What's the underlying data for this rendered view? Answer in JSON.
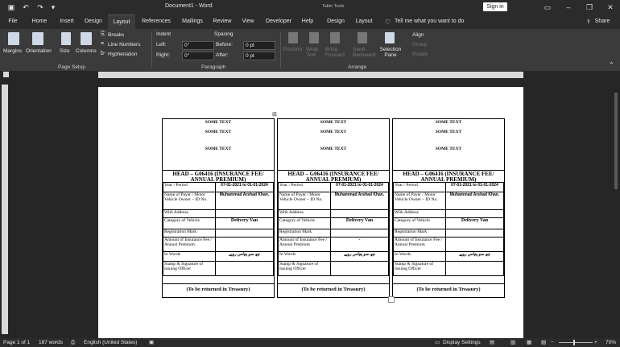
{
  "window": {
    "title": "Document1 - Word",
    "context_label": "Table Tools",
    "signin": "Sign in"
  },
  "quick_access": {
    "undo": "↶",
    "redo": "↷"
  },
  "tabs": [
    {
      "label": "File"
    },
    {
      "label": "Home"
    },
    {
      "label": "Insert"
    },
    {
      "label": "Design"
    },
    {
      "label": "Layout"
    },
    {
      "label": "References"
    },
    {
      "label": "Mailings"
    },
    {
      "label": "Review"
    },
    {
      "label": "View"
    },
    {
      "label": "Developer"
    },
    {
      "label": "Help"
    },
    {
      "label": "Design"
    },
    {
      "label": "Layout"
    }
  ],
  "tell_me": "Tell me what you want to do",
  "share": "Share",
  "ribbon": {
    "margins": "Margins",
    "orientation": "Orientation",
    "size": "Size",
    "columns": "Columns",
    "breaks": "Breaks",
    "line_numbers": "Line Numbers",
    "hyphenation": "Hyphenation",
    "page_setup_label": "Page Setup",
    "indent_label": "Indent",
    "spacing_label": "Spacing",
    "left_label": "Left:",
    "right_label": "Right:",
    "before_label": "Before:",
    "after_label": "After:",
    "left_value": "0\"",
    "right_value": "0\"",
    "before_value": "0 pt",
    "after_value": "0 pt",
    "paragraph_label": "Paragraph",
    "position": "Position",
    "wrap_text": "Wrap Text",
    "bring_forward": "Bring Forward",
    "send_backward": "Send Backward",
    "selection_pane": "Selection Pane",
    "align": "Align",
    "group": "Group",
    "rotate": "Rotate",
    "arrange_label": "Arrange"
  },
  "cards": [
    {
      "some_text": [
        "SOME TEXT",
        "SOME TEXT",
        "SOME TEXT"
      ],
      "head": "HEAD – G06416 (INSURANCE FEE/ ANNUAL PREMIUM)",
      "rows": [
        {
          "label": "Year / Period",
          "value": "07-01-2021 to 01-01-2024"
        },
        {
          "label": "Name of Payer / Motor Vehicle Owner – ID No.",
          "value": "Muhammad Arshad Khan."
        },
        {
          "label": "With Address",
          "value": ""
        },
        {
          "label": "Category of Vehicle",
          "value": "Delivery Van"
        },
        {
          "label": "Registration Mark",
          "value": ""
        },
        {
          "label": "Amount of Insurance Fee / Annual Premium",
          "value": ""
        },
        {
          "label": "In Words",
          "value": "چھ سو پچاس روپے"
        },
        {
          "label": "Stamp & Signature of Issuing Officer",
          "value": ""
        }
      ],
      "footer": "(To be returned in Treasury)"
    },
    {
      "some_text": [
        "SOME TEXT",
        "SOME TEXT",
        "SOME TEXT"
      ],
      "head": "HEAD – G06416 (INSURANCE FEE/ ANNUAL PREMIUM)",
      "rows": [
        {
          "label": "Year / Period",
          "value": "07-01-2021 to 01-01-2024"
        },
        {
          "label": "Name of Payer / Motor Vehicle Owner – ID No.",
          "value": "Muhammad Arshad Khan."
        },
        {
          "label": "With Address",
          "value": ""
        },
        {
          "label": "Category of Vehicle",
          "value": "Delivery Van"
        },
        {
          "label": "Registration Mark",
          "value": ""
        },
        {
          "label": "Amount of Insurance Fee / Annual Premium",
          "value": "-"
        },
        {
          "label": "In Words",
          "value": "چھ سو پچاس روپے"
        },
        {
          "label": "Stamp & Signature of Issuing Officer",
          "value": ""
        }
      ],
      "footer": "(To be returned in Treasury)"
    },
    {
      "some_text": [
        "SOME TEXT",
        "SOME TEXT",
        "SOME TEXT"
      ],
      "head": "HEAD – G06416 (INSURANCE FEE/ ANNUAL PREMIUM)",
      "rows": [
        {
          "label": "Year / Period",
          "value": "07-01-2021 to 01-01-2024"
        },
        {
          "label": "Name of Payer / Motor Vehicle Owner – ID No.",
          "value": "Muhammad Arshad Khan."
        },
        {
          "label": "With Address",
          "value": ""
        },
        {
          "label": "Category of Vehicle",
          "value": "Delivery Van"
        },
        {
          "label": "Registration Mark",
          "value": ""
        },
        {
          "label": "Amount of Insurance Fee / Annual Premium",
          "value": ""
        },
        {
          "label": "In Words",
          "value": "چھ سو پچاس روپے"
        },
        {
          "label": "Stamp & Signature of Issuing Officer",
          "value": ""
        }
      ],
      "footer": "(To be returned in Treasury)"
    }
  ],
  "status": {
    "page": "Page 1 of 1",
    "words": "187 words",
    "language": "English (United States)",
    "display_settings": "Display Settings",
    "zoom": "70%"
  },
  "colors": {
    "ribbon_bg": "#3b3b3b",
    "titlebar_bg": "#2b2b2b",
    "canvas_bg": "#262626"
  }
}
